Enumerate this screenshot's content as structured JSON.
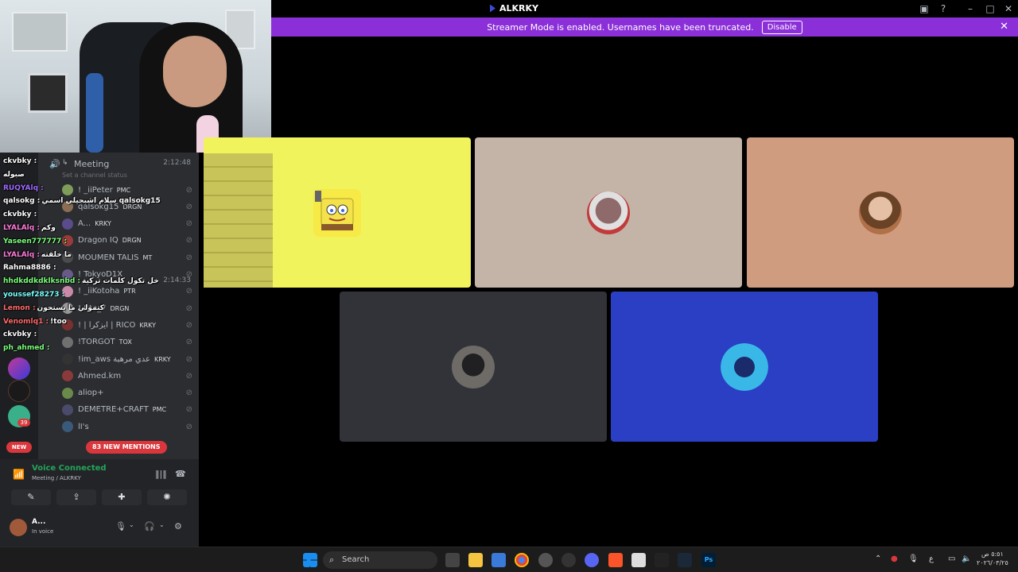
{
  "window": {
    "title": "ALKRKY"
  },
  "banner": {
    "message": "Streamer Mode is enabled. Usernames have been truncated.",
    "button": "Disable"
  },
  "sidebar": {
    "meeting_channel": "Meeting",
    "meeting_status_placeholder": "Set a channel status",
    "time_1": "2:12:48",
    "time_2": "2:14:33",
    "members": [
      {
        "name": "! _iiPeter",
        "tag": "PMC",
        "color": "#7e9c5a"
      },
      {
        "name": "qalsokg15",
        "tag": "DRGN",
        "color": "#8a6d53"
      },
      {
        "name": "A...",
        "tag": "KRKY",
        "color": "#5a4b8a"
      },
      {
        "name": "Dragon IQ",
        "tag": "DRGN",
        "color": "#9a3b3b"
      },
      {
        "name": "MOUMEN TALIS",
        "tag": "MT",
        "color": "#4b4b4b"
      },
      {
        "name": "! TokyoD1X",
        "tag": "",
        "color": "#6a5a8a"
      },
      {
        "name": "! _iiKotoha",
        "tag": "PTR",
        "color": "#c88aa8"
      },
      {
        "name": "! Itto_7",
        "tag": "DRGN",
        "color": "#999999"
      },
      {
        "name": "! | ايزكرا | RICO",
        "tag": "KRKY",
        "color": "#7a3030"
      },
      {
        "name": "!TORGOT",
        "tag": "TOX",
        "color": "#707070"
      },
      {
        "name": "!im_aws عدي مرهبة",
        "tag": "KRKY",
        "color": "#333333"
      },
      {
        "name": "Ahmed.km",
        "tag": "",
        "color": "#8a3a3a"
      },
      {
        "name": "aliop+",
        "tag": "",
        "color": "#6a8a4a"
      },
      {
        "name": "DEMETRE+CRAFT",
        "tag": "PMC",
        "color": "#4a4a6a"
      },
      {
        "name": "lI's",
        "tag": "",
        "color": "#3a5a7a"
      }
    ],
    "new_mentions": "83 NEW MENTIONS",
    "new_badge": "NEW",
    "server_badge": "39"
  },
  "chat": [
    {
      "user": "ckvbky :",
      "msg": "",
      "color": "#ffffff"
    },
    {
      "user": "",
      "msg": "صبوله",
      "color": "#ff6a6a"
    },
    {
      "user": "RUQYAlq :",
      "msg": "",
      "color": "#a06aff"
    },
    {
      "user": "qalsokg :",
      "msg": "سلام اشبجيلي اسمي qalsokg15",
      "color": "#ffffff"
    },
    {
      "user": "ckvbky :",
      "msg": "",
      "color": "#ffffff"
    },
    {
      "user": "LYALAlq :",
      "msg": "وكم",
      "color": "#ff7ad9"
    },
    {
      "user": "Yaseen777777 :",
      "msg": "",
      "color": "#7aff7a"
    },
    {
      "user": "LYALAlq :",
      "msg": "ما خلقته",
      "color": "#ff7ad9"
    },
    {
      "user": "Rahma8886 :",
      "msg": "",
      "color": "#ffffff"
    },
    {
      "user": "hhdkddkdklksnbd :",
      "msg": "خل تكول كلمات تركية",
      "color": "#7aff7a"
    },
    {
      "user": "youssef28273 :",
      "msg": "",
      "color": "#7affff"
    },
    {
      "user": "Lemon :",
      "msg": "كتمولي ما يستحون",
      "color": "#ff6a6a"
    },
    {
      "user": "Venomlq1 :",
      "msg": "!too",
      "color": "#ff6a6a"
    },
    {
      "user": "ckvbky :",
      "msg": "",
      "color": "#ffffff"
    },
    {
      "user": "ph_ahmed :",
      "msg": "",
      "color": "#7aff7a"
    }
  ],
  "voice": {
    "status": "Voice Connected",
    "channel": "Meeting / ALKRKY",
    "user_name": "A...",
    "user_status": "In voice"
  },
  "tiles": [
    {
      "name": "tile-spongebob",
      "color": "#f1f35c"
    },
    {
      "name": "tile-user-2",
      "color": "#c4b3a7"
    },
    {
      "name": "tile-user-3",
      "color": "#d09c7f"
    },
    {
      "name": "tile-user-4",
      "color": "#313338"
    },
    {
      "name": "tile-user-5",
      "color": "#2a3fc4"
    }
  ],
  "taskbar": {
    "search_placeholder": "Search",
    "clock_time": "٥:٥١ ص",
    "clock_date": "٢٠٢٦/٠٣/٢٥",
    "lang": "ع"
  }
}
